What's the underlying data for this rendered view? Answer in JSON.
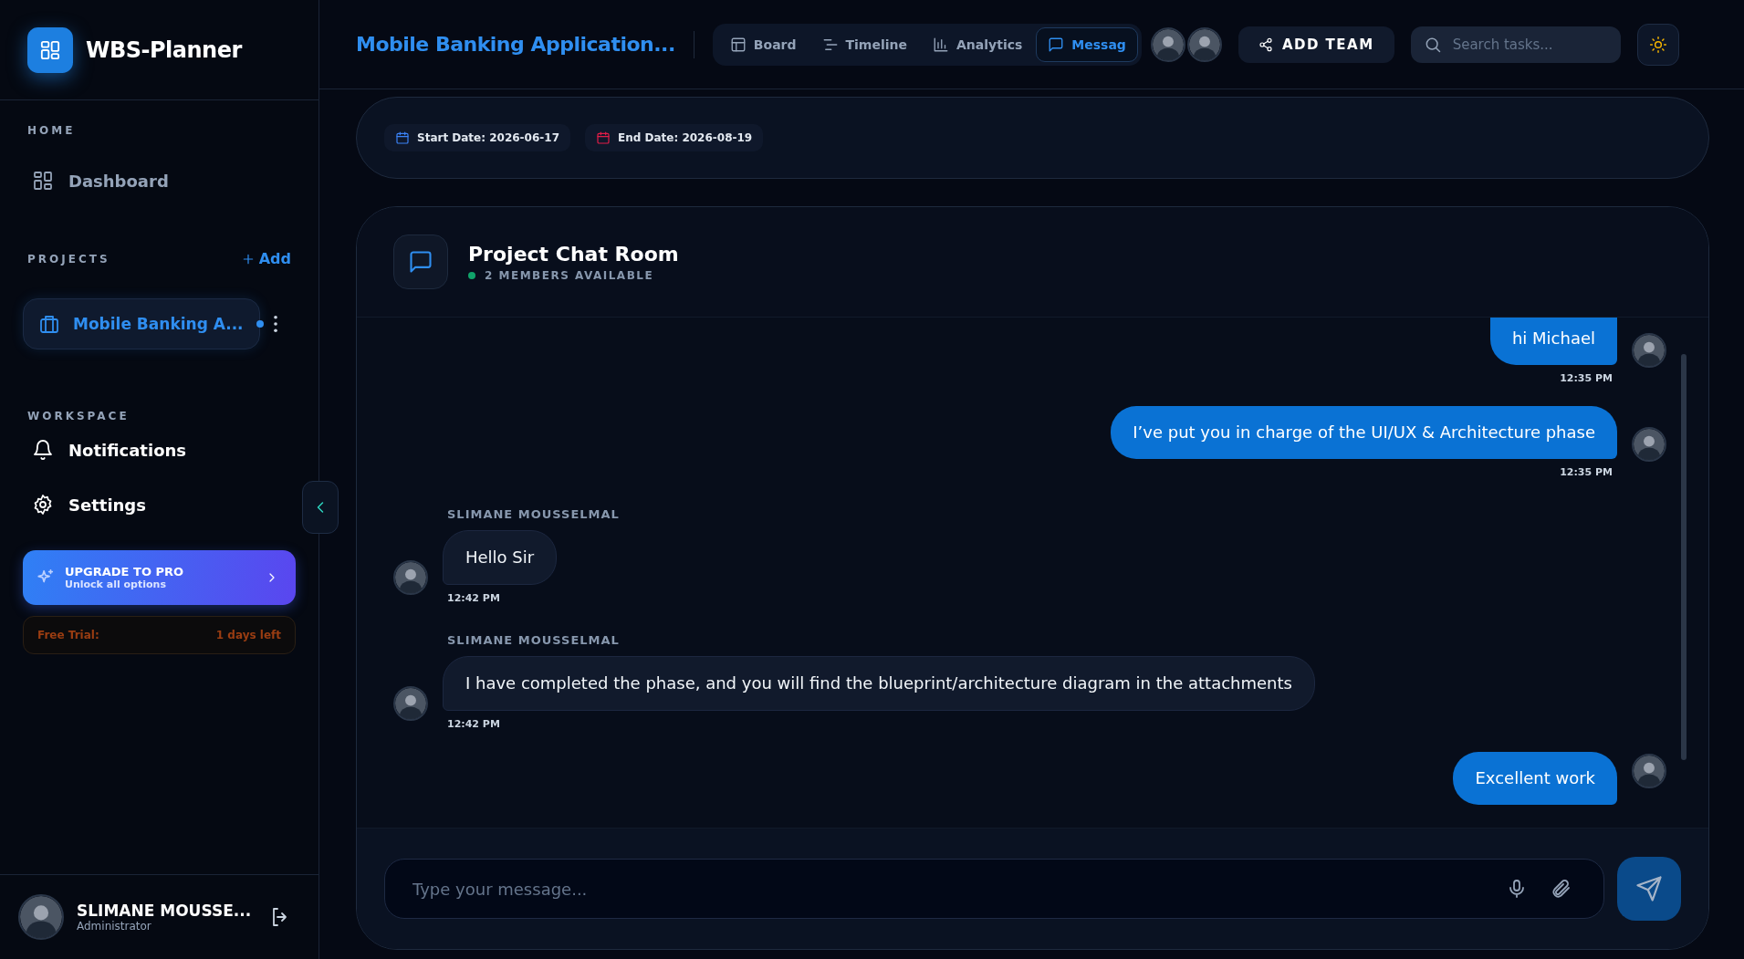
{
  "brand": {
    "name": "WBS-Planner"
  },
  "sidebar": {
    "home": {
      "title": "HOME",
      "items": [
        {
          "label": "Dashboard"
        }
      ]
    },
    "projects": {
      "title": "PROJECTS",
      "add_label": "Add",
      "items": [
        {
          "label": "Mobile Banking A...",
          "selected": true
        }
      ]
    },
    "workspace": {
      "title": "WORKSPACE",
      "items": [
        {
          "label": "Notifications"
        },
        {
          "label": "Settings"
        }
      ]
    },
    "upgrade": {
      "title": "UPGRADE TO PRO",
      "subtitle": "Unlock all options"
    },
    "trial": {
      "label": "Free Trial:",
      "remaining": "1 days left"
    },
    "user": {
      "name": "SLIMANE MOUSSE...",
      "role": "Administrator"
    }
  },
  "header": {
    "project_title": "Mobile Banking Application...",
    "tabs": [
      {
        "label": "Board",
        "selected": false
      },
      {
        "label": "Timeline",
        "selected": false
      },
      {
        "label": "Analytics",
        "selected": false
      },
      {
        "label": "Messag",
        "selected": true
      }
    ],
    "team_button": "ADD TEAM",
    "search": {
      "placeholder": "Search tasks..."
    }
  },
  "dates": [
    {
      "label": "Start Date: 2026-06-17",
      "color": "#3b82f6"
    },
    {
      "label": "End Date: 2026-08-19",
      "color": "#e11d48"
    }
  ],
  "chat": {
    "title": "Project Chat Room",
    "status": "2 MEMBERS AVAILABLE",
    "messages": [
      {
        "kind": "sent",
        "text": "hi Michael",
        "time": "12:35 PM"
      },
      {
        "kind": "sent",
        "text": "I’ve put you in charge of the UI/UX & Architecture phase",
        "time": "12:35 PM"
      },
      {
        "kind": "received",
        "sender": "SLIMANE MOUSSELMAL",
        "text": "Hello Sir",
        "time": "12:42 PM"
      },
      {
        "kind": "received",
        "sender": "SLIMANE MOUSSELMAL",
        "text": "I have completed the phase, and you will find the blueprint/architecture diagram in the attachments",
        "time": "12:42 PM"
      },
      {
        "kind": "sent",
        "text": "Excellent work"
      }
    ],
    "input": {
      "placeholder": "Type your message..."
    }
  }
}
